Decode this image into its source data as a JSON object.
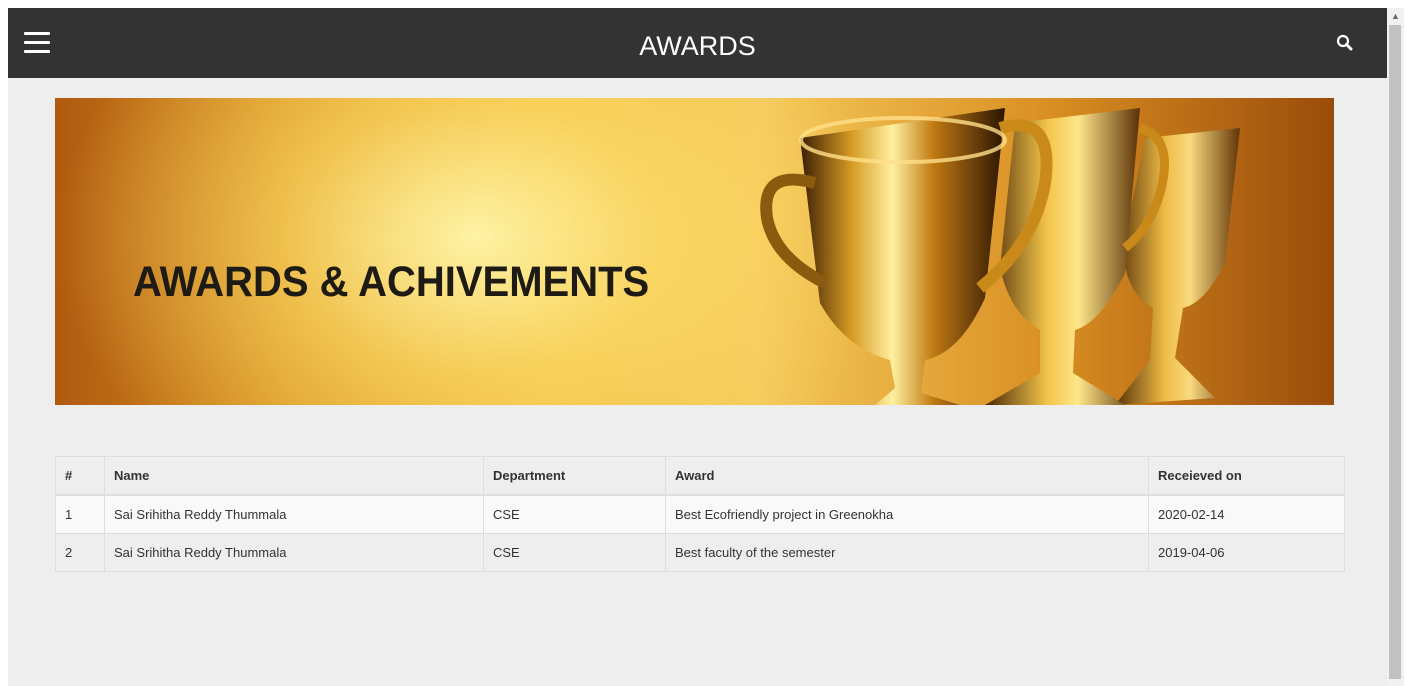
{
  "header": {
    "title": "AWARDS",
    "menu_icon": "hamburger-menu-icon",
    "search_icon": "search-icon"
  },
  "banner": {
    "title": "AWARDS & ACHIVEMENTS",
    "image": "golden-trophies"
  },
  "table": {
    "columns": [
      "#",
      "Name",
      "Department",
      "Award",
      "Receieved on"
    ],
    "rows": [
      [
        "1",
        "Sai Srihitha Reddy Thummala",
        "CSE",
        "Best Ecofriendly project in Greenokha",
        "2020-02-14"
      ],
      [
        "2",
        "Sai Srihitha Reddy Thummala",
        "CSE",
        "Best faculty of the semester",
        "2019-04-06"
      ]
    ]
  },
  "colors": {
    "topbar": "#333333",
    "page_background": "#eeeeee",
    "banner_gold": "#efba40"
  }
}
